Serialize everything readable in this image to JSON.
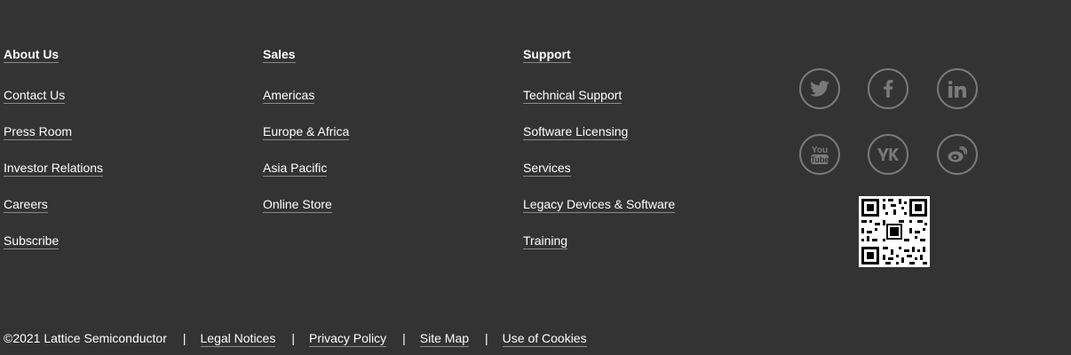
{
  "columns": [
    {
      "title": "About Us",
      "links": [
        "Contact Us",
        "Press Room",
        "Investor Relations",
        "Careers",
        "Subscribe"
      ]
    },
    {
      "title": "Sales",
      "links": [
        "Americas",
        "Europe & Africa",
        "Asia Pacific",
        "Online Store"
      ]
    },
    {
      "title": "Support",
      "links": [
        "Technical Support",
        "Software Licensing",
        "Services",
        "Legacy Devices & Software",
        "Training"
      ]
    }
  ],
  "social": {
    "icons": [
      "twitter-icon",
      "facebook-icon",
      "linkedin-icon",
      "youtube-icon",
      "vk-icon",
      "weibo-icon"
    ],
    "icon_color": "#7a7a7a"
  },
  "footer": {
    "copyright": "©2021 Lattice Semiconductor",
    "separator": "|",
    "links": [
      "Legal Notices",
      "Privacy Policy",
      "Site Map",
      "Use of Cookies"
    ]
  },
  "colors": {
    "background": "#333333",
    "text": "#ffffff",
    "underline": "#8a8a8a"
  }
}
